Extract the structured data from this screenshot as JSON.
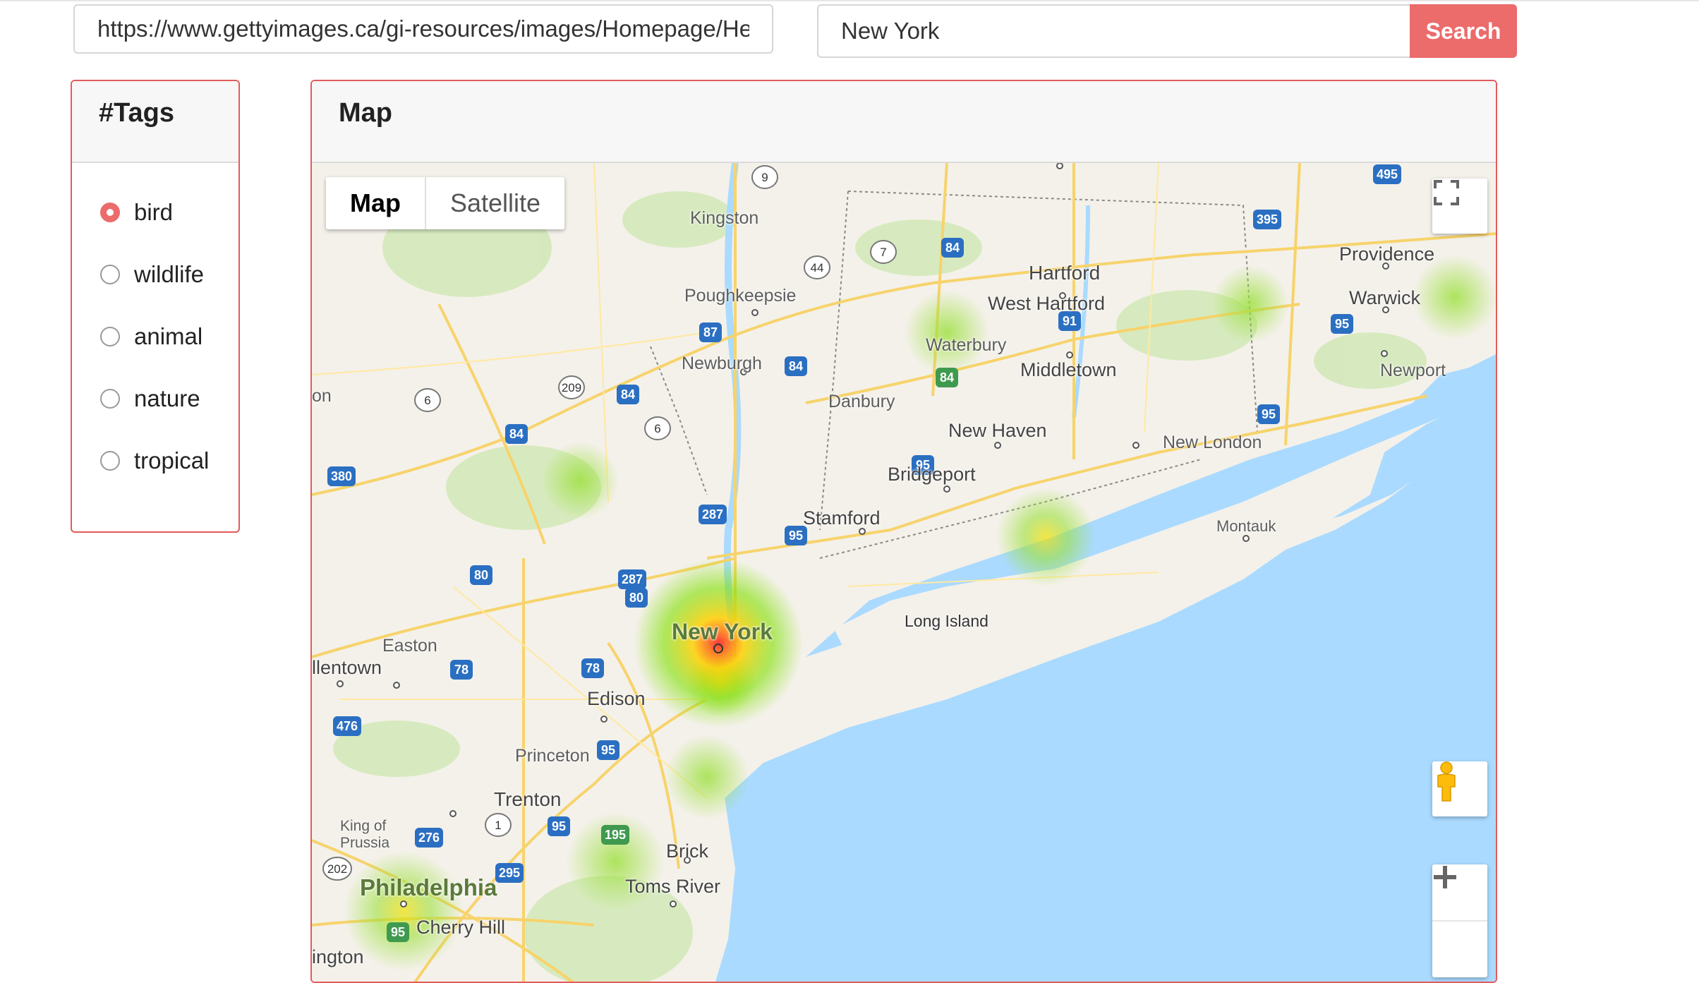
{
  "search": {
    "url_value": "https://www.gettyimages.ca/gi-resources/images/Homepage/He",
    "location_value": "New York",
    "button_label": "Search"
  },
  "tags_panel": {
    "title": "#Tags",
    "items": [
      {
        "label": "bird",
        "selected": true
      },
      {
        "label": "wildlife",
        "selected": false
      },
      {
        "label": "animal",
        "selected": false
      },
      {
        "label": "nature",
        "selected": false
      },
      {
        "label": "tropical",
        "selected": false
      }
    ]
  },
  "map_panel": {
    "title": "Map",
    "map_types": [
      "Map",
      "Satellite"
    ],
    "active_map_type": "Map",
    "controls": [
      "fullscreen-icon",
      "pegman-icon",
      "zoom-in-icon",
      "zoom-out-icon"
    ]
  },
  "map_labels": {
    "new_york": "New York",
    "philadelphia": "Philadelphia",
    "long_island": "Long Island",
    "kingston": "Kingston",
    "poughkeepsie": "Poughkeepsie",
    "newburgh": "Newburgh",
    "danbury": "Danbury",
    "waterbury": "Waterbury",
    "hartford": "Hartford",
    "west_hartford": "West Hartford",
    "middletown": "Middletown",
    "new_haven": "New Haven",
    "bridgeport": "Bridgeport",
    "stamford": "Stamford",
    "new_london": "New London",
    "providence": "Providence",
    "warwick": "Warwick",
    "newport": "Newport",
    "montauk": "Montauk",
    "easton": "Easton",
    "allentown": "llentown",
    "edison": "Edison",
    "princeton": "Princeton",
    "trenton": "Trenton",
    "brick": "Brick",
    "toms_river": "Toms River",
    "king_of_prussia_1": "King of",
    "king_of_prussia_2": "Prussia",
    "cherry_hill": "Cherry Hill",
    "wilmington": "ington",
    "on": "on"
  },
  "highway_shields": [
    "9",
    "87",
    "44",
    "7",
    "84",
    "395",
    "495",
    "91",
    "95",
    "209",
    "6",
    "380",
    "287",
    "80",
    "78",
    "476",
    "1",
    "276",
    "295",
    "195",
    "202"
  ],
  "colors": {
    "accent": "#ec6b6b",
    "water": "#aadaff",
    "land": "#f4f1ea"
  }
}
